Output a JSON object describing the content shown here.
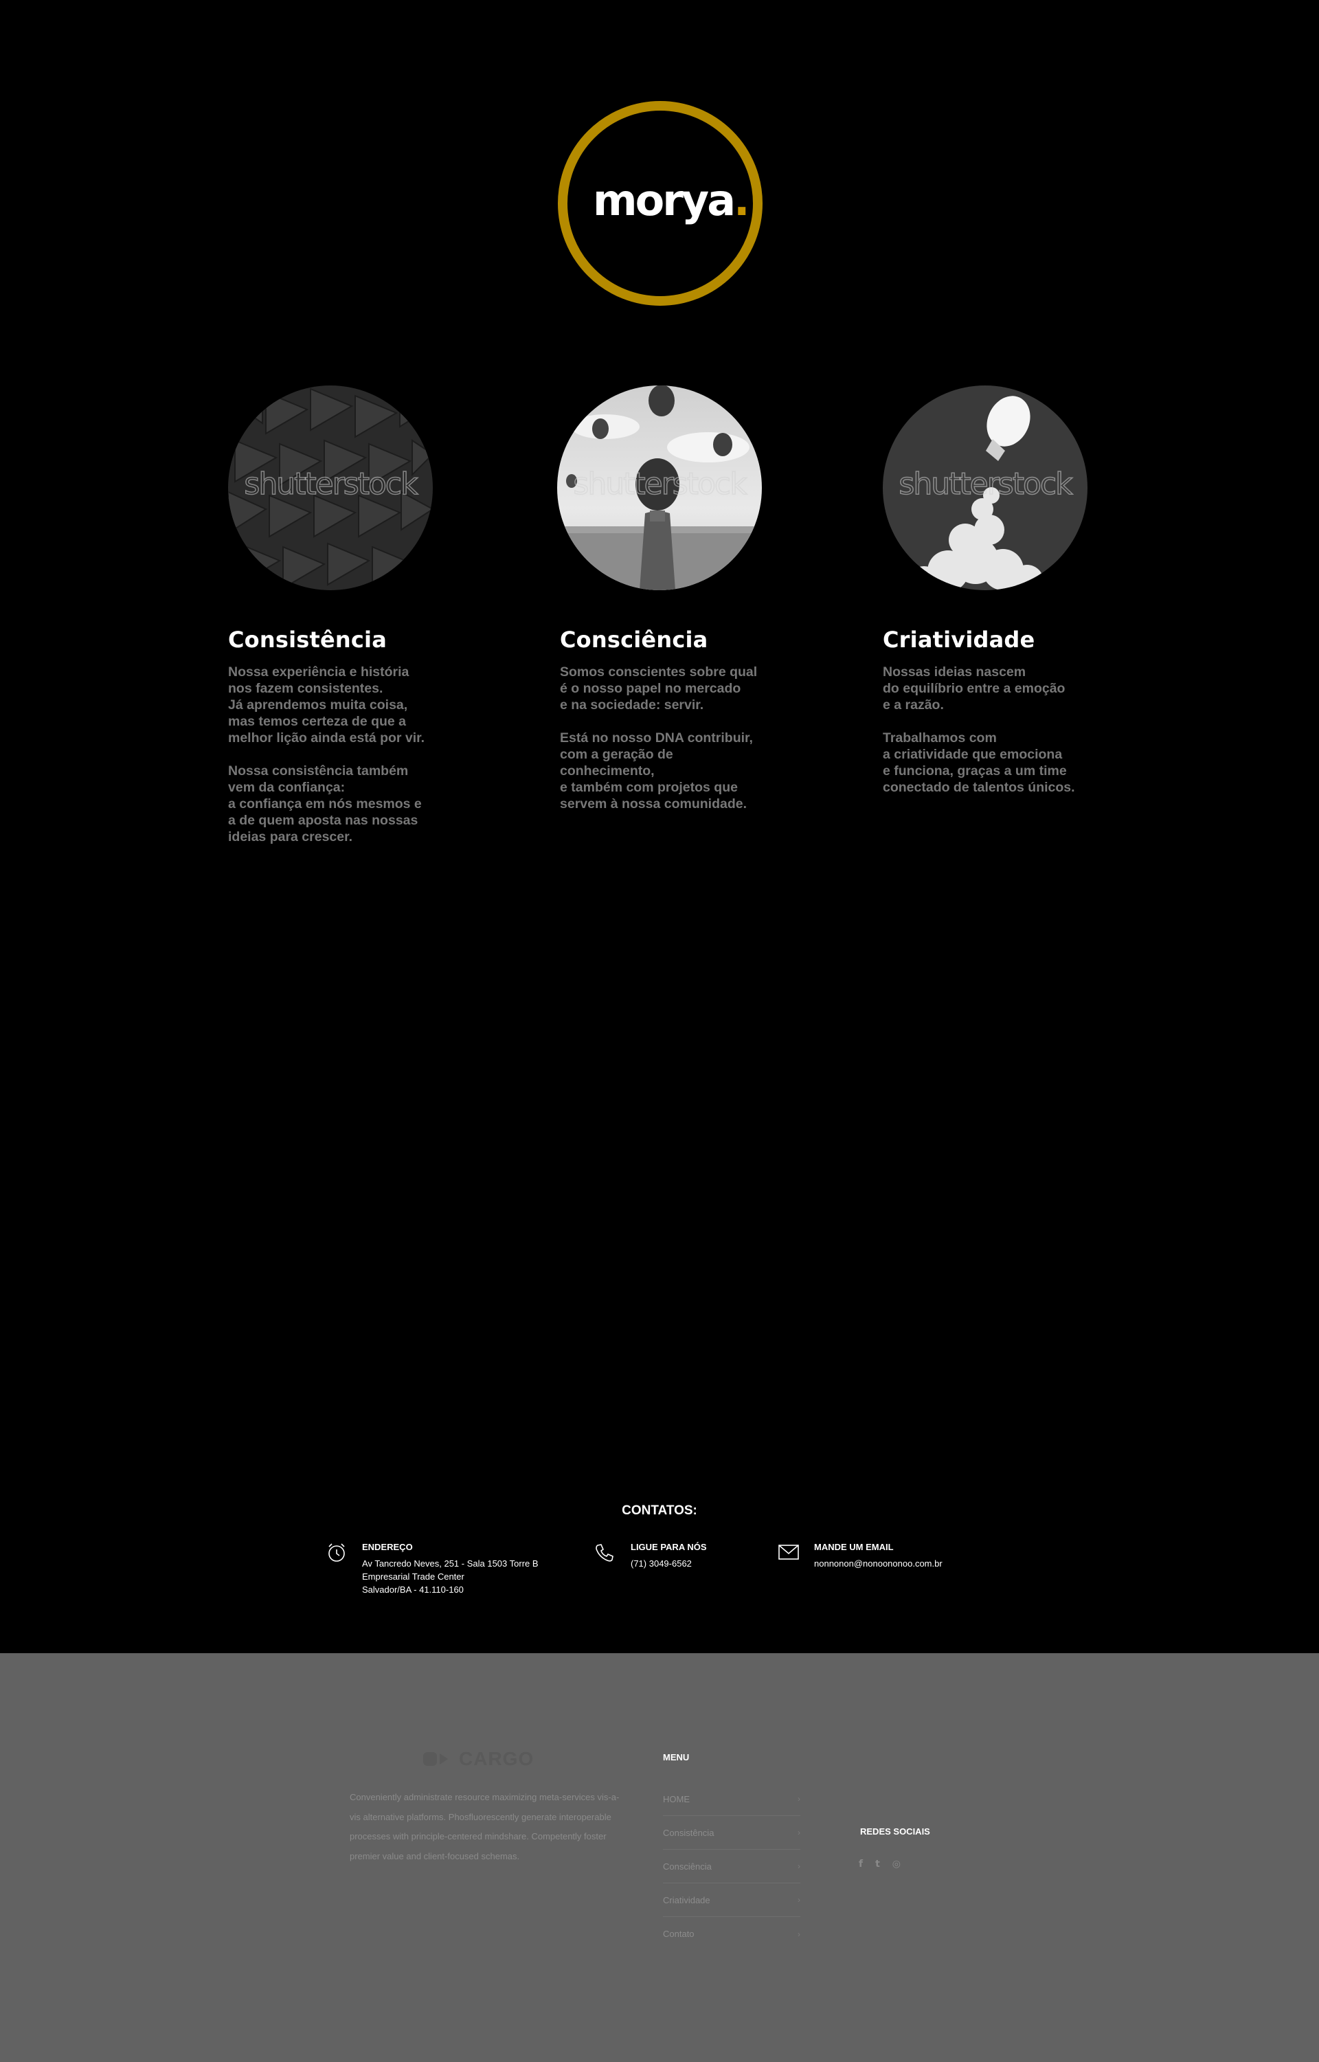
{
  "brand": {
    "name": "morya",
    "dot": ".",
    "ring_color": "#b58b00"
  },
  "images": {
    "watermark": "shutterstock"
  },
  "columns": [
    {
      "title": "Consistência",
      "body": "Nossa experiência e história\nnos fazem consistentes.\nJá aprendemos muita coisa,\nmas temos certeza de que a\nmelhor lição ainda está por vir.\n\nNossa consistência também\nvem da confiança:\na confiança em nós mesmos e\na de quem aposta nas nossas\nideias para crescer."
    },
    {
      "title": "Consciência",
      "body": "Somos conscientes sobre qual\né o nosso papel no mercado\ne na sociedade: servir.\n\nEstá no nosso DNA contribuir,\ncom a geração de\nconhecimento,\ne também com projetos que\nservem à nossa comunidade."
    },
    {
      "title": "Criatividade",
      "body": "Nossas ideias nascem\ndo equilíbrio entre a emoção\ne a razão.\n\nTrabalhamos com\na criatividade que emociona\ne funciona, graças a um time\nconectado de talentos únicos."
    }
  ],
  "contacts": {
    "title": "CONTATOS:",
    "address": {
      "label": "ENDEREÇO",
      "value": "Av Tancredo Neves, 251 - Sala 1503 Torre B\nEmpresarial Trade Center\nSalvador/BA - 41.110-160",
      "icon": "alarm-clock-icon"
    },
    "phone": {
      "label": "LIGUE PARA NÓS",
      "value": "(71) 3049-6562",
      "icon": "phone-icon"
    },
    "email": {
      "label": "MANDE UM EMAIL",
      "value": "nonnonon@nonoononoo.com.br",
      "icon": "envelope-icon"
    }
  },
  "footer": {
    "logo_text": "CARGO",
    "description": "Conveniently administrate resource maximizing meta-services vis-a-vis alternative platforms. Phosfluorescently generate interoperable processes with principle-centered mindshare. Competently foster premier value and client-focused schemas.",
    "menu_title": "MENU",
    "menu": [
      "HOME",
      "Consistência",
      "Consciência",
      "Criatividade",
      "Contato"
    ],
    "social_title": "REDES SOCIAIS",
    "social": [
      {
        "name": "facebook",
        "glyph": "f"
      },
      {
        "name": "twitter",
        "glyph": "t"
      },
      {
        "name": "instagram",
        "glyph": "◎"
      }
    ]
  }
}
